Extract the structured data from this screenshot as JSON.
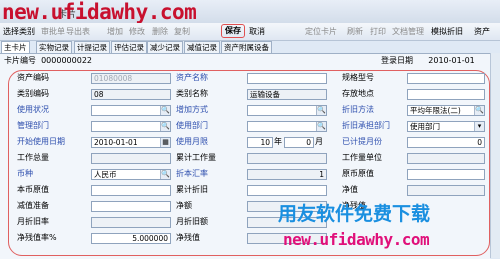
{
  "watermark_top": "new.ufidawhy.com",
  "window_title": "卡片",
  "toolbar": {
    "items": [
      "选择类别",
      "审批单",
      "导出表",
      "增加",
      "修改",
      "删除",
      "复制",
      "保存",
      "取消",
      "定位卡片",
      "刷新",
      "打印",
      "文档管理",
      "模拟折旧",
      "资产"
    ]
  },
  "tabs": [
    "主卡片",
    "实物记录",
    "计提记录",
    "评估记录",
    "减少记录",
    "减值记录",
    "资产附属设备"
  ],
  "card": {
    "label": "卡片编号",
    "value": "0000000022"
  },
  "register_date": {
    "label": "登录日期",
    "value": "2010-01-01"
  },
  "fields": {
    "asset_code": {
      "label": "资产编码",
      "value": "01080008"
    },
    "asset_name": {
      "label": "资产名称",
      "value": ""
    },
    "spec": {
      "label": "规格型号",
      "value": ""
    },
    "category_code": {
      "label": "类别编码",
      "value": "08"
    },
    "category_name": {
      "label": "类别名称",
      "value": "运输设备"
    },
    "location": {
      "label": "存放地点",
      "value": ""
    },
    "use_status": {
      "label": "使用状况",
      "value": ""
    },
    "add_method": {
      "label": "增加方式",
      "value": ""
    },
    "dep_method": {
      "label": "折旧方法",
      "value": "平均年限法(二)"
    },
    "mgmt_dept": {
      "label": "管理部门",
      "value": ""
    },
    "use_dept": {
      "label": "使用部门",
      "value": ""
    },
    "dep_bearing_dept": {
      "label": "折旧承担部门",
      "value": "使用部门"
    },
    "start_date": {
      "label": "开始使用日期",
      "value": "2010-01-01"
    },
    "use_months": {
      "label": "使用月限",
      "value_year": "10",
      "unit_year": "年",
      "value_month": "0",
      "unit_month": "月"
    },
    "used_months": {
      "label": "已计提月份",
      "value": "0"
    },
    "total_workload": {
      "label": "工作总量",
      "value": ""
    },
    "acc_workload": {
      "label": "累计工作量",
      "value": ""
    },
    "work_unit": {
      "label": "工作量单位",
      "value": ""
    },
    "currency": {
      "label": "币种",
      "value": "人民币"
    },
    "exchange_rate": {
      "label": "折本汇率",
      "value": "1"
    },
    "orig_value": {
      "label": "原币原值",
      "value": ""
    },
    "base_value": {
      "label": "本币原值",
      "value": ""
    },
    "acc_dep": {
      "label": "累计折旧",
      "value": ""
    },
    "net_value": {
      "label": "净值",
      "value": ""
    },
    "impairment": {
      "label": "减值准备",
      "value": ""
    },
    "net_amount": {
      "label": "净额",
      "value": ""
    },
    "residual": {
      "label": "净残值",
      "value": ""
    },
    "monthly_dep": {
      "label": "月折旧率",
      "value": ""
    },
    "monthly_dep_amt": {
      "label": "月折旧额",
      "value": ""
    },
    "prov_vat": {
      "label": "净残值率%",
      "value": "5.000000"
    },
    "net_residual": {
      "label": "净残值",
      "value": ""
    }
  },
  "watermark_bottom": "用友软件免费下载",
  "watermark_url": "new.ufidawhy.com"
}
